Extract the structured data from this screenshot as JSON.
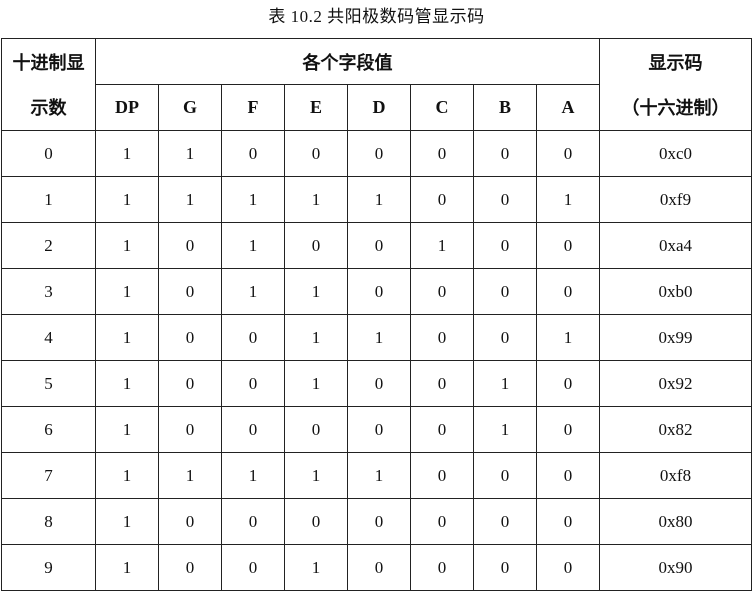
{
  "caption": "表 10.2 共阳极数码管显示码",
  "header": {
    "left_top": "十进制显",
    "left_bottom": "示数",
    "group": "各个字段值",
    "right_top": "显示码",
    "right_bottom": "（十六进制）",
    "bits": [
      "DP",
      "G",
      "F",
      "E",
      "D",
      "C",
      "B",
      "A"
    ]
  },
  "rows": [
    {
      "num": "0",
      "bits": [
        "1",
        "1",
        "0",
        "0",
        "0",
        "0",
        "0",
        "0"
      ],
      "code": "0xc0"
    },
    {
      "num": "1",
      "bits": [
        "1",
        "1",
        "1",
        "1",
        "1",
        "0",
        "0",
        "1"
      ],
      "code": "0xf9"
    },
    {
      "num": "2",
      "bits": [
        "1",
        "0",
        "1",
        "0",
        "0",
        "1",
        "0",
        "0"
      ],
      "code": "0xa4"
    },
    {
      "num": "3",
      "bits": [
        "1",
        "0",
        "1",
        "1",
        "0",
        "0",
        "0",
        "0"
      ],
      "code": "0xb0"
    },
    {
      "num": "4",
      "bits": [
        "1",
        "0",
        "0",
        "1",
        "1",
        "0",
        "0",
        "1"
      ],
      "code": "0x99"
    },
    {
      "num": "5",
      "bits": [
        "1",
        "0",
        "0",
        "1",
        "0",
        "0",
        "1",
        "0"
      ],
      "code": "0x92"
    },
    {
      "num": "6",
      "bits": [
        "1",
        "0",
        "0",
        "0",
        "0",
        "0",
        "1",
        "0"
      ],
      "code": "0x82"
    },
    {
      "num": "7",
      "bits": [
        "1",
        "1",
        "1",
        "1",
        "1",
        "0",
        "0",
        "0"
      ],
      "code": "0xf8"
    },
    {
      "num": "8",
      "bits": [
        "1",
        "0",
        "0",
        "0",
        "0",
        "0",
        "0",
        "0"
      ],
      "code": "0x80"
    },
    {
      "num": "9",
      "bits": [
        "1",
        "0",
        "0",
        "1",
        "0",
        "0",
        "0",
        "0"
      ],
      "code": "0x90"
    }
  ]
}
